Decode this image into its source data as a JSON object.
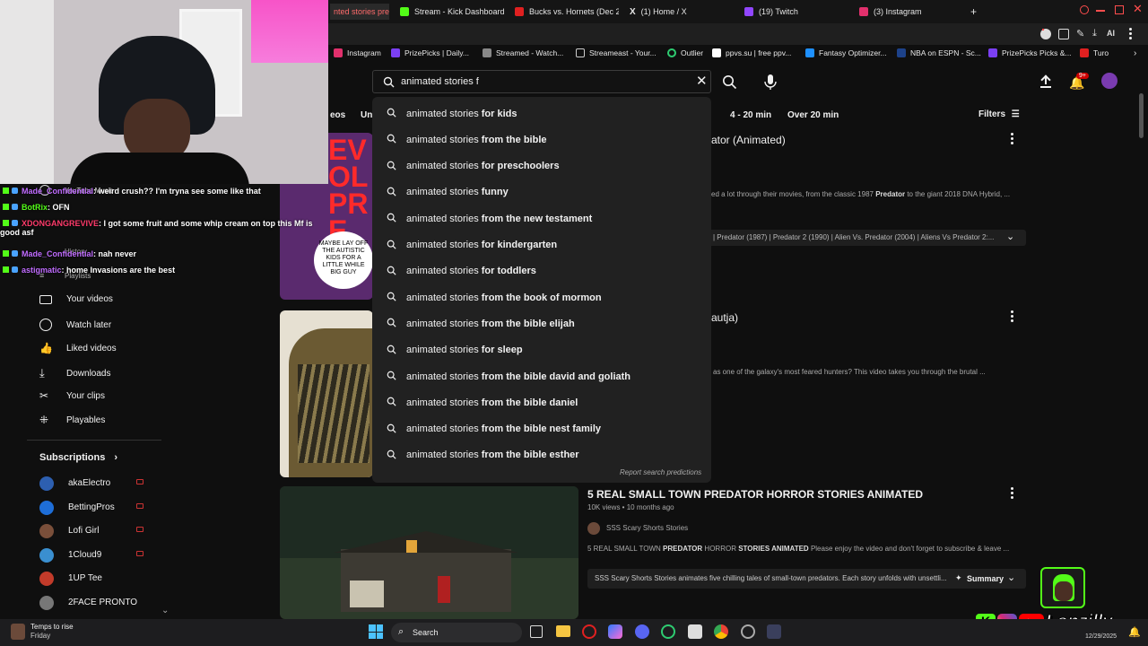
{
  "browser": {
    "tabs": [
      {
        "label": "nted stories preda",
        "color": "#ff3b30"
      },
      {
        "label": "Stream - Kick Dashboard",
        "color": "#53fc18"
      },
      {
        "label": "Bucks vs. Hornets (Dec 2",
        "color": "#e02020"
      },
      {
        "label": "(1) Home / X",
        "color": "#ffffff"
      },
      {
        "label": "(19) Twitch",
        "color": "#9146ff"
      },
      {
        "label": "(3) Instagram",
        "color": "#e1306c"
      }
    ],
    "new_tab": "+",
    "bookmarks": [
      "Instagram",
      "PrizePicks | Daily...",
      "Streamed - Watch...",
      "Streameast - Your...",
      "Outlier",
      "ppvs.su | free ppv...",
      "Fantasy Optimizer...",
      "NBA on ESPN - Sc...",
      "PrizePicks Picks &...",
      "Turo"
    ],
    "ai_label": "AI"
  },
  "search": {
    "value": "animated stories f",
    "suggestions": [
      {
        "prefix": "animated stories ",
        "rest": "for kids"
      },
      {
        "prefix": "animated stories ",
        "rest": "from the bible"
      },
      {
        "prefix": "animated stories ",
        "rest": "for preschoolers"
      },
      {
        "prefix": "animated stories ",
        "rest": "funny"
      },
      {
        "prefix": "animated stories ",
        "rest": "from the new testament"
      },
      {
        "prefix": "animated stories ",
        "rest": "for kindergarten"
      },
      {
        "prefix": "animated stories ",
        "rest": "for toddlers"
      },
      {
        "prefix": "animated stories ",
        "rest": "from the book of mormon"
      },
      {
        "prefix": "animated stories ",
        "rest": "from the bible elijah"
      },
      {
        "prefix": "animated stories ",
        "rest": "for sleep"
      },
      {
        "prefix": "animated stories ",
        "rest": "from the bible david and goliath"
      },
      {
        "prefix": "animated stories ",
        "rest": "from the bible daniel"
      },
      {
        "prefix": "animated stories ",
        "rest": "from the bible nest family"
      },
      {
        "prefix": "animated stories ",
        "rest": "from the bible esther"
      }
    ],
    "report": "Report search predictions"
  },
  "header": {
    "notif_badge": "9+"
  },
  "chips": [
    "eos",
    "Un",
    "4 - 20 min",
    "Over 20 min"
  ],
  "filters_label": "Filters",
  "sidebar": {
    "top_items": [
      "YouTube Music",
      "History",
      "Playlists"
    ],
    "items": [
      "Your videos",
      "Watch later",
      "Liked videos",
      "Downloads",
      "Your clips",
      "Playables"
    ],
    "subs_title": "Subscriptions",
    "subs": [
      {
        "name": "akaElectro",
        "color": "#2d5fb0"
      },
      {
        "name": "BettingPros",
        "color": "#1e6ed8"
      },
      {
        "name": "Lofi Girl",
        "color": "#7a4f3a"
      },
      {
        "name": "1Cloud9",
        "color": "#3a8fd0"
      },
      {
        "name": "1UP Tee",
        "color": "#c23b2a"
      },
      {
        "name": "2FACE PRONTO",
        "color": "#777"
      }
    ]
  },
  "chat": [
    {
      "user": "Made_Confidential",
      "msg": ": weird crush?? I'm tryna see some like that",
      "color": "#c06cff"
    },
    {
      "user": "BotRix",
      "msg": ": OFN",
      "color": "#53fc18"
    },
    {
      "user": "XDONGANGREVIVE",
      "msg": ": I got some fruit and some whip cream on top this Mf is good asf",
      "color": "#ff3b6b"
    },
    {
      "user": "Made_Confidential",
      "msg": ": nah never",
      "color": "#c06cff"
    },
    {
      "user": "astigmatic",
      "msg": ": home Invasions are the best",
      "color": "#c06cff"
    }
  ],
  "results": [
    {
      "title": "ator (Animated)",
      "desc_pre": "ed a lot through their movies, from the classic 1987 ",
      "desc_bold": "Predator",
      "desc_post": " to the giant 2018 DNA Hybrid, ...",
      "chapters": "| Predator (1987) | Predator 2 (1990) | Alien Vs. Predator (2004) | Aliens Vs Predator 2:...",
      "thumb_text": "MAYBE LAY OFF THE AUTISTIC KIDS FOR A LITTLE WHILE BIG GUY",
      "thumb_big": "EVOL PRE"
    },
    {
      "title": "autja)",
      "desc_pre": "as one of the galaxy's most feared hunters? This video takes you through the brutal ..."
    },
    {
      "title": "5 REAL SMALL TOWN PREDATOR HORROR STORIES ANIMATED",
      "meta": "10K views • 10 months ago",
      "channel": "SSS Scary Shorts Stories",
      "desc_a": "5 REAL SMALL TOWN ",
      "desc_b": "PREDATOR",
      "desc_c": " HORROR ",
      "desc_d": "STORIES ANIMATED",
      "desc_e": " Please enjoy the video and don't forget to subscribe & leave ...",
      "summary_text": "SSS Scary Shorts Stories animates five chilling tales of small-town predators. Each story unfolds with unsettli...",
      "summary_label": "Summary"
    }
  ],
  "overlay": {
    "brand": "Lonzilly"
  },
  "taskbar": {
    "weather": "Temps to rise",
    "day": "Friday",
    "search": "Search",
    "date": "12/29/2025"
  }
}
